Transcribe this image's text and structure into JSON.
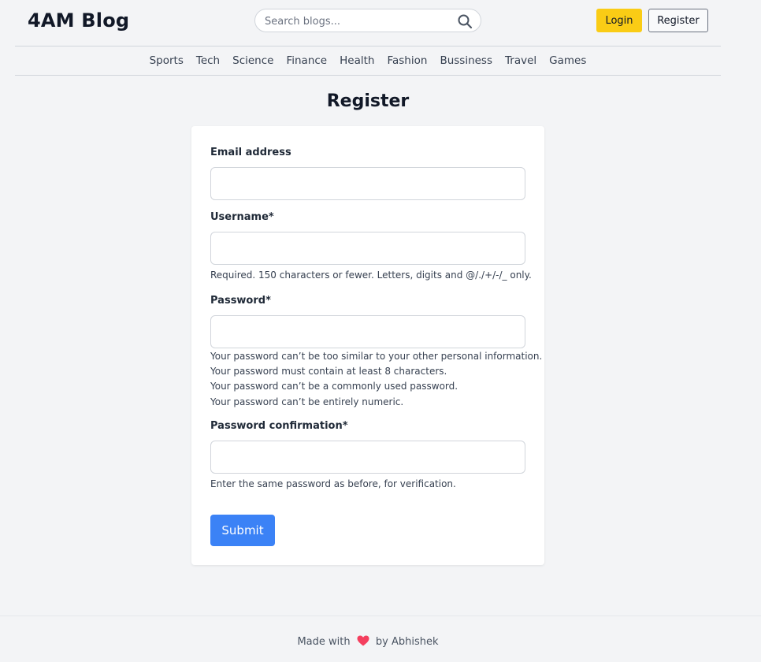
{
  "header": {
    "brand": "4AM Blog",
    "search_placeholder": "Search blogs...",
    "login_label": "Login",
    "register_label": "Register"
  },
  "nav": {
    "items": [
      "Sports",
      "Tech",
      "Science",
      "Finance",
      "Health",
      "Fashion",
      "Bussiness",
      "Travel",
      "Games"
    ]
  },
  "main": {
    "title": "Register",
    "email_label": "Email address",
    "username_label": "Username*",
    "username_help": "Required. 150 characters or fewer. Letters, digits and @/./+/-/_ only.",
    "password_label": "Password*",
    "password_help": [
      "Your password can’t be too similar to your other personal information.",
      "Your password must contain at least 8 characters.",
      "Your password can’t be a commonly used password.",
      "Your password can’t be entirely numeric."
    ],
    "password_confirm_label": "Password confirmation*",
    "password_confirm_help": "Enter the same password as before, for verification.",
    "submit_label": "Submit"
  },
  "footer": {
    "prefix": "Made with",
    "suffix": "by Abhishek"
  },
  "colors": {
    "accent_yellow": "#facc15",
    "submit_blue": "#3b82f6",
    "heart": "#f43f5e"
  },
  "icons": {
    "search": "search-icon",
    "heart": "heart-icon"
  }
}
